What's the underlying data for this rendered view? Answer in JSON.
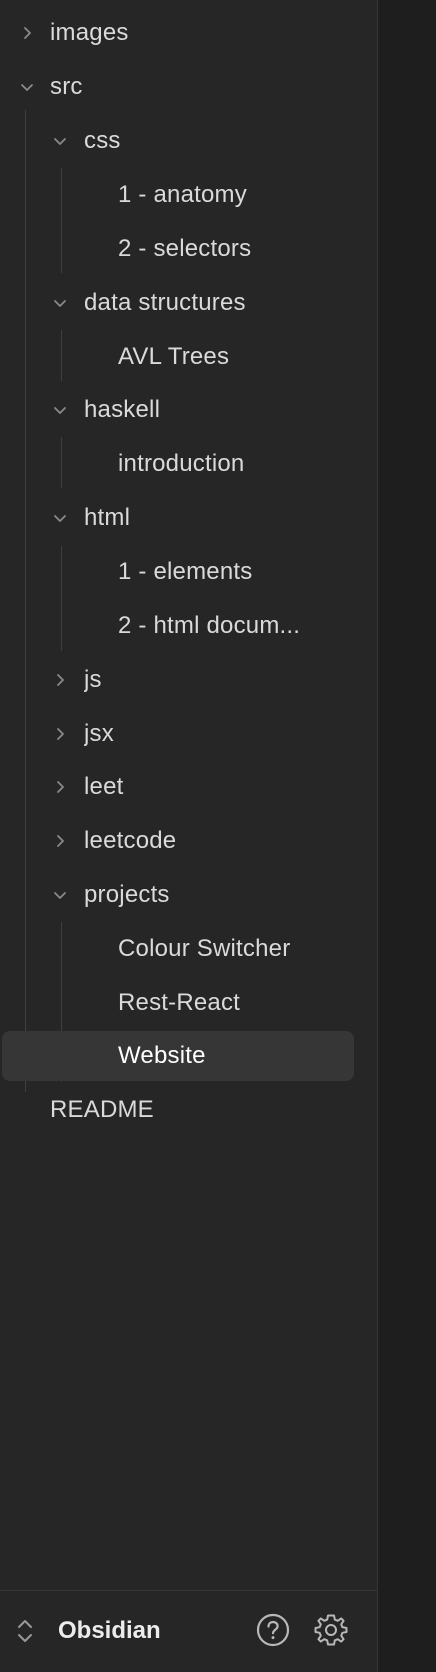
{
  "tree": {
    "root_folders": [
      {
        "label": "images",
        "expanded": false,
        "icon": "chevron-right-icon"
      },
      {
        "label": "src",
        "expanded": true,
        "icon": "chevron-down-icon"
      }
    ],
    "src_children": {
      "css": {
        "label": "css",
        "expanded": true,
        "files": [
          "1 - anatomy",
          "2 - selectors"
        ]
      },
      "data_structures": {
        "label": "data structures",
        "expanded": true,
        "files": [
          "AVL Trees"
        ]
      },
      "haskell": {
        "label": "haskell",
        "expanded": true,
        "files": [
          "introduction"
        ]
      },
      "html": {
        "label": "html",
        "expanded": true,
        "files": [
          "1 - elements",
          "2 - html docum..."
        ]
      },
      "js": {
        "label": "js",
        "expanded": false
      },
      "jsx": {
        "label": "jsx",
        "expanded": false
      },
      "leet": {
        "label": "leet",
        "expanded": false
      },
      "leetcode": {
        "label": "leetcode",
        "expanded": false
      },
      "projects": {
        "label": "projects",
        "expanded": true,
        "files": [
          "Colour Switcher",
          "Rest-React",
          "Website"
        ]
      }
    },
    "root_files": [
      "README"
    ],
    "selected_file": "Website"
  },
  "footer": {
    "vault_name": "Obsidian",
    "icons": [
      "chevron-up-down-icon",
      "help-icon",
      "gear-icon"
    ]
  },
  "colors": {
    "sidebar_bg": "#262626",
    "selected_bg": "#363636",
    "text": "#dadada",
    "chevron": "#8a8a8a",
    "guide": "#3e3e3e"
  }
}
